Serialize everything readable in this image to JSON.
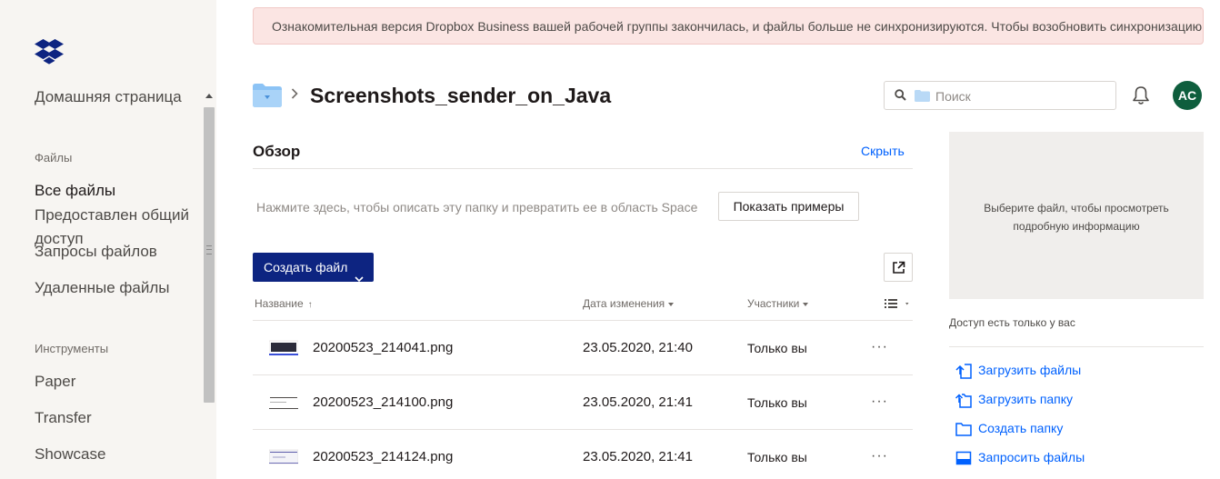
{
  "sidebar": {
    "items": [
      {
        "label": "Домашняя страница"
      },
      {
        "label": "Файлы"
      },
      {
        "label": "Все файлы"
      },
      {
        "label": "Предоставлен общий доступ"
      },
      {
        "label": "Запросы файлов"
      },
      {
        "label": "Удаленные файлы"
      },
      {
        "label": "Инструменты"
      },
      {
        "label": "Paper"
      },
      {
        "label": "Transfer"
      },
      {
        "label": "Showcase"
      }
    ]
  },
  "banner": {
    "text": "Ознакомительная версия Dropbox Business вашей рабочей группы закончилась, и файлы больше не синхронизируются. Чтобы возобновить синхронизацию"
  },
  "header": {
    "title": "Screenshots_sender_on_Java",
    "search_placeholder": "Поиск",
    "avatar_initials": "AC"
  },
  "overview": {
    "title": "Обзор",
    "hide_label": "Скрыть",
    "description": "Нажмите здесь, чтобы описать эту папку и превратить ее в область Space",
    "examples_button": "Показать примеры"
  },
  "actions": {
    "create_file_label": "Создать файл"
  },
  "table": {
    "columns": {
      "name": "Название",
      "modified": "Дата изменения",
      "members": "Участники"
    },
    "rows": [
      {
        "name": "20200523_214041.png",
        "modified": "23.05.2020, 21:40",
        "members": "Только вы",
        "more": "···"
      },
      {
        "name": "20200523_214100.png",
        "modified": "23.05.2020, 21:41",
        "members": "Только вы",
        "more": "···"
      },
      {
        "name": "20200523_214124.png",
        "modified": "23.05.2020, 21:41",
        "members": "Только вы",
        "more": "···"
      }
    ]
  },
  "details": {
    "placeholder": "Выберите файл, чтобы просмотреть подробную информацию",
    "access": "Доступ есть только у вас",
    "actions": [
      {
        "label": "Загрузить файлы",
        "icon": "upload-file-icon"
      },
      {
        "label": "Загрузить папку",
        "icon": "upload-folder-icon"
      },
      {
        "label": "Создать папку",
        "icon": "new-folder-icon"
      },
      {
        "label": "Запросить файлы",
        "icon": "request-files-icon"
      }
    ]
  },
  "colors": {
    "brand": "#0061fe",
    "create_button": "#0d2481",
    "avatar": "#0e5e3d",
    "banner_bg": "#fbe5e3",
    "sidebar_bg": "#f7f5f2"
  }
}
